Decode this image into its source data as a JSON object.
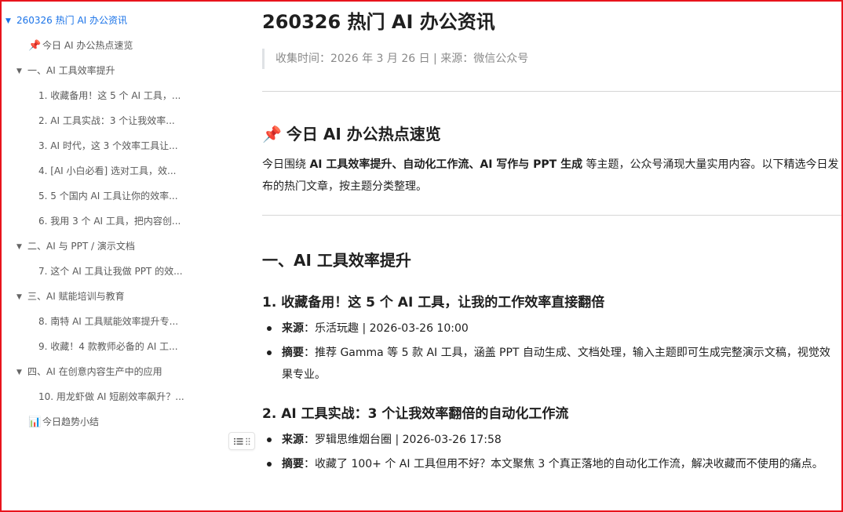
{
  "toc": {
    "items": [
      {
        "label": "260326 热门 AI 办公资讯",
        "level": 0,
        "arrow": "▼",
        "active": true
      },
      {
        "label": "今日 AI 办公热点速览",
        "level": 1,
        "emoji": "📌"
      },
      {
        "label": "一、AI 工具效率提升",
        "level": 1,
        "arrow": "▼"
      },
      {
        "label": "1. 收藏备用！这 5 个 AI 工具，...",
        "level": 2
      },
      {
        "label": "2. AI 工具实战：3 个让我效率...",
        "level": 2
      },
      {
        "label": "3. AI 时代，这 3 个效率工具让...",
        "level": 2
      },
      {
        "label": "4. [AI 小白必看] 选对工具，效...",
        "level": 2
      },
      {
        "label": "5. 5 个国内 AI 工具让你的效率...",
        "level": 2
      },
      {
        "label": "6. 我用 3 个 AI 工具，把内容创...",
        "level": 2
      },
      {
        "label": "二、AI 与 PPT / 演示文档",
        "level": 1,
        "arrow": "▼"
      },
      {
        "label": "7. 这个 AI 工具让我做 PPT 的效...",
        "level": 2
      },
      {
        "label": "三、AI 赋能培训与教育",
        "level": 1,
        "arrow": "▼"
      },
      {
        "label": "8. 南特 AI 工具赋能效率提升专...",
        "level": 2
      },
      {
        "label": "9. 收藏！4 款教师必备的 AI 工...",
        "level": 2
      },
      {
        "label": "四、AI 在创意内容生产中的应用",
        "level": 1,
        "arrow": "▼"
      },
      {
        "label": "10. 用龙虾做 AI 短剧效率飙升？...",
        "level": 2
      },
      {
        "label": "今日趋势小结",
        "level": 1,
        "emoji": "📊"
      }
    ]
  },
  "doc": {
    "title": "260326 热门 AI 办公资讯",
    "meta": "收集时间：2026 年 3 月 26 日 | 来源：微信公众号",
    "hot": {
      "emoji": "📌",
      "heading": "今日 AI 办公热点速览",
      "intro_prefix": "今日围绕 ",
      "intro_bold": "AI 工具效率提升、自动化工作流、AI 写作与 PPT 生成",
      "intro_suffix": " 等主题，公众号涌现大量实用内容。以下精选今日发布的热门文章，按主题分类整理。"
    },
    "section1": {
      "heading": "一、AI 工具效率提升",
      "articles": [
        {
          "title": "1. 收藏备用！这 5 个 AI 工具，让我的工作效率直接翻倍",
          "source_label": "来源",
          "source": "：乐活玩趣 | 2026-03-26 10:00",
          "summary_label": "摘要",
          "summary": "：推荐 Gamma 等 5 款 AI 工具，涵盖 PPT 自动生成、文档处理，输入主题即可生成完整演示文稿，视觉效果专业。"
        },
        {
          "title": "2. AI 工具实战：3 个让我效率翻倍的自动化工作流",
          "source_label": "来源",
          "source": "：罗辑思维烟台圈 | 2026-03-26 17:58",
          "summary_label": "摘要",
          "summary": "：收藏了 100+ 个 AI 工具但用不好？本文聚焦 3 个真正落地的自动化工作流，解决收藏而不使用的痛点。"
        }
      ]
    }
  },
  "icons": {
    "block_handle": "list-drag-handle-icon",
    "pin": "pushpin-icon",
    "chart": "bar-chart-icon"
  },
  "colors": {
    "accent": "#1a73e8",
    "frame": "#e8141c"
  }
}
